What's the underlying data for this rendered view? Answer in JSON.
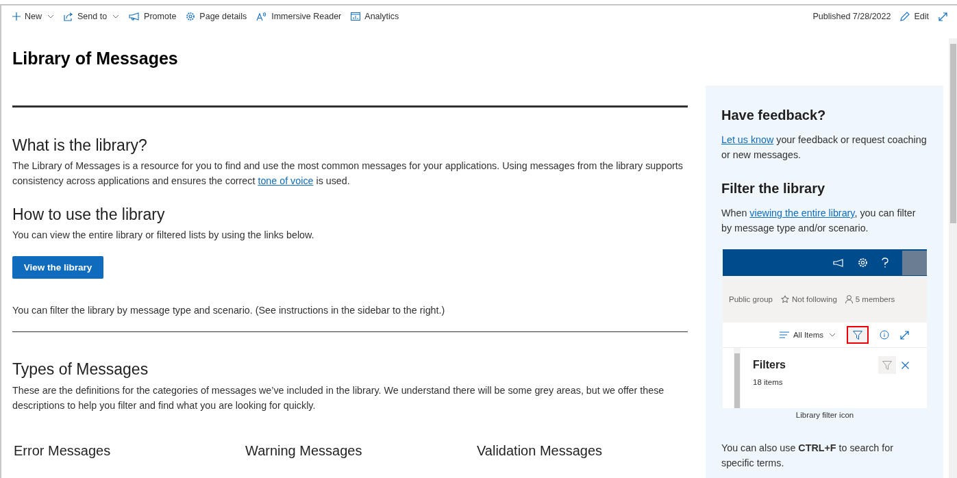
{
  "toolbar": {
    "items": [
      {
        "kind": "new",
        "label": "New",
        "dropdown": true
      },
      {
        "kind": "send",
        "label": "Send to",
        "dropdown": true
      },
      {
        "kind": "promote",
        "label": "Promote",
        "dropdown": false
      },
      {
        "kind": "details",
        "label": "Page details",
        "dropdown": false
      },
      {
        "kind": "reader",
        "label": "Immersive Reader",
        "dropdown": false
      },
      {
        "kind": "analytics",
        "label": "Analytics",
        "dropdown": false
      }
    ],
    "published": "Published 7/28/2022",
    "edit": "Edit"
  },
  "page_title": "Library of Messages",
  "main": {
    "sections": [
      {
        "heading": "What is the library?",
        "paragraphs": [
          {
            "before": "The Library of Messages is a resource for you to find and use the most common messages for your applications. Using messages from the library supports consistency across applications and ensures the correct ",
            "link": "tone of voice",
            "after": " is used."
          }
        ]
      },
      {
        "heading": "How to use the library",
        "paragraphs": [
          {
            "before": "You can view the entire library or filtered lists by using the links below."
          }
        ],
        "button": "View the library",
        "note": "You can filter the library by message type and scenario. (See instructions in the sidebar to the right.)"
      }
    ],
    "types": {
      "heading": "Types of Messages",
      "text": "These are the definitions for the categories of messages we’ve included in the library. We understand there will be some grey areas, but we offer these descriptions to help you filter and find what you are looking for quickly.",
      "columns": [
        "Error Messages",
        "Warning Messages",
        "Validation Messages"
      ]
    }
  },
  "sidebar": {
    "feedback": {
      "heading": "Have feedback?",
      "link": "Let us know",
      "after": " your feedback or request coaching or new messages."
    },
    "filter": {
      "heading": "Filter the library",
      "before": "When ",
      "link": "viewing the entire library",
      "after": ", you can filter by message type and/or scenario."
    },
    "screenshot": {
      "group": "Public group",
      "following": "Not following",
      "members": "5 members",
      "view": "All Items",
      "panel_title": "Filters",
      "count": "18 items",
      "filter_highlighted": true
    },
    "caption": "Library filter icon",
    "tip": "You can also use **CTRL+F** to search for specific terms."
  }
}
